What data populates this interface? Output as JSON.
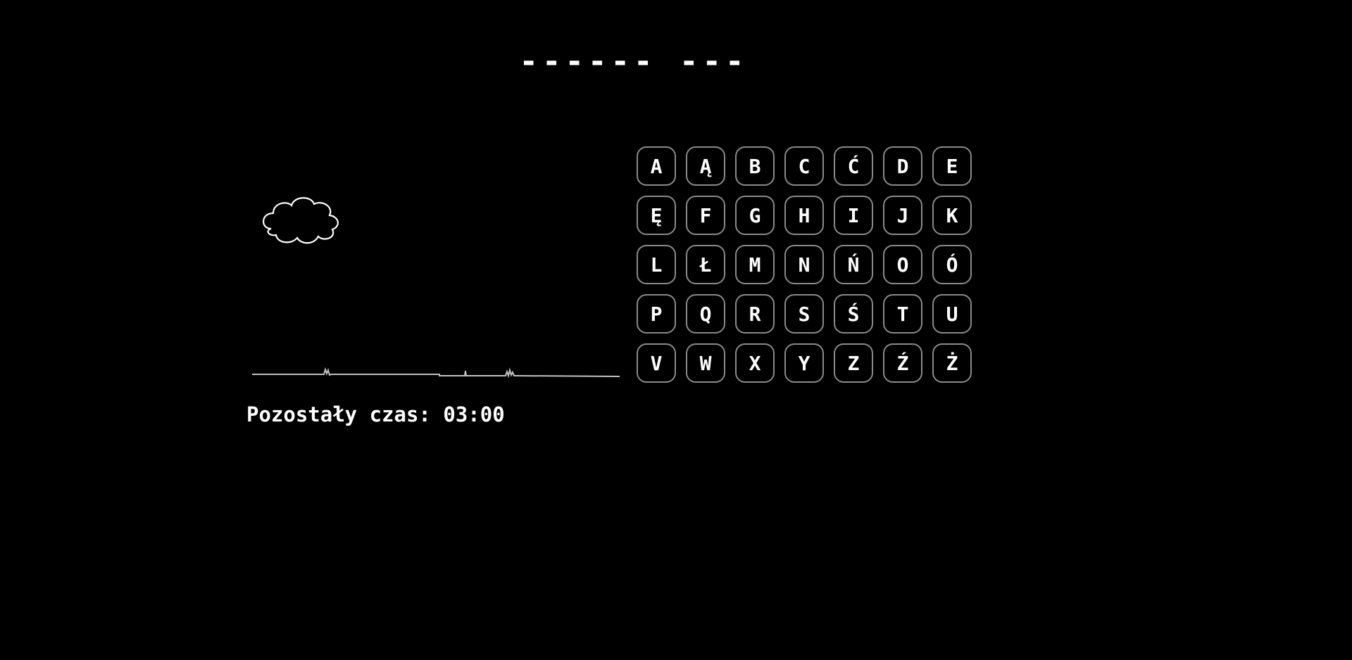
{
  "game": {
    "word_mask": "------ ---",
    "timer_label": "Pozostały czas:",
    "timer_value": "03:00"
  },
  "keyboard": {
    "letters": [
      "A",
      "Ą",
      "B",
      "C",
      "Ć",
      "D",
      "E",
      "Ę",
      "F",
      "G",
      "H",
      "I",
      "J",
      "K",
      "L",
      "Ł",
      "M",
      "N",
      "Ń",
      "O",
      "Ó",
      "P",
      "Q",
      "R",
      "S",
      "Ś",
      "T",
      "U",
      "V",
      "W",
      "X",
      "Y",
      "Z",
      "Ź",
      "Ż"
    ]
  },
  "colors": {
    "background": "#000000",
    "text": "#ffffff",
    "key_border": "#8a8a8a",
    "ground_line": "#bfbfbf"
  },
  "icons": {
    "cloud": "cloud-icon",
    "ground": "grass-ground-line"
  }
}
